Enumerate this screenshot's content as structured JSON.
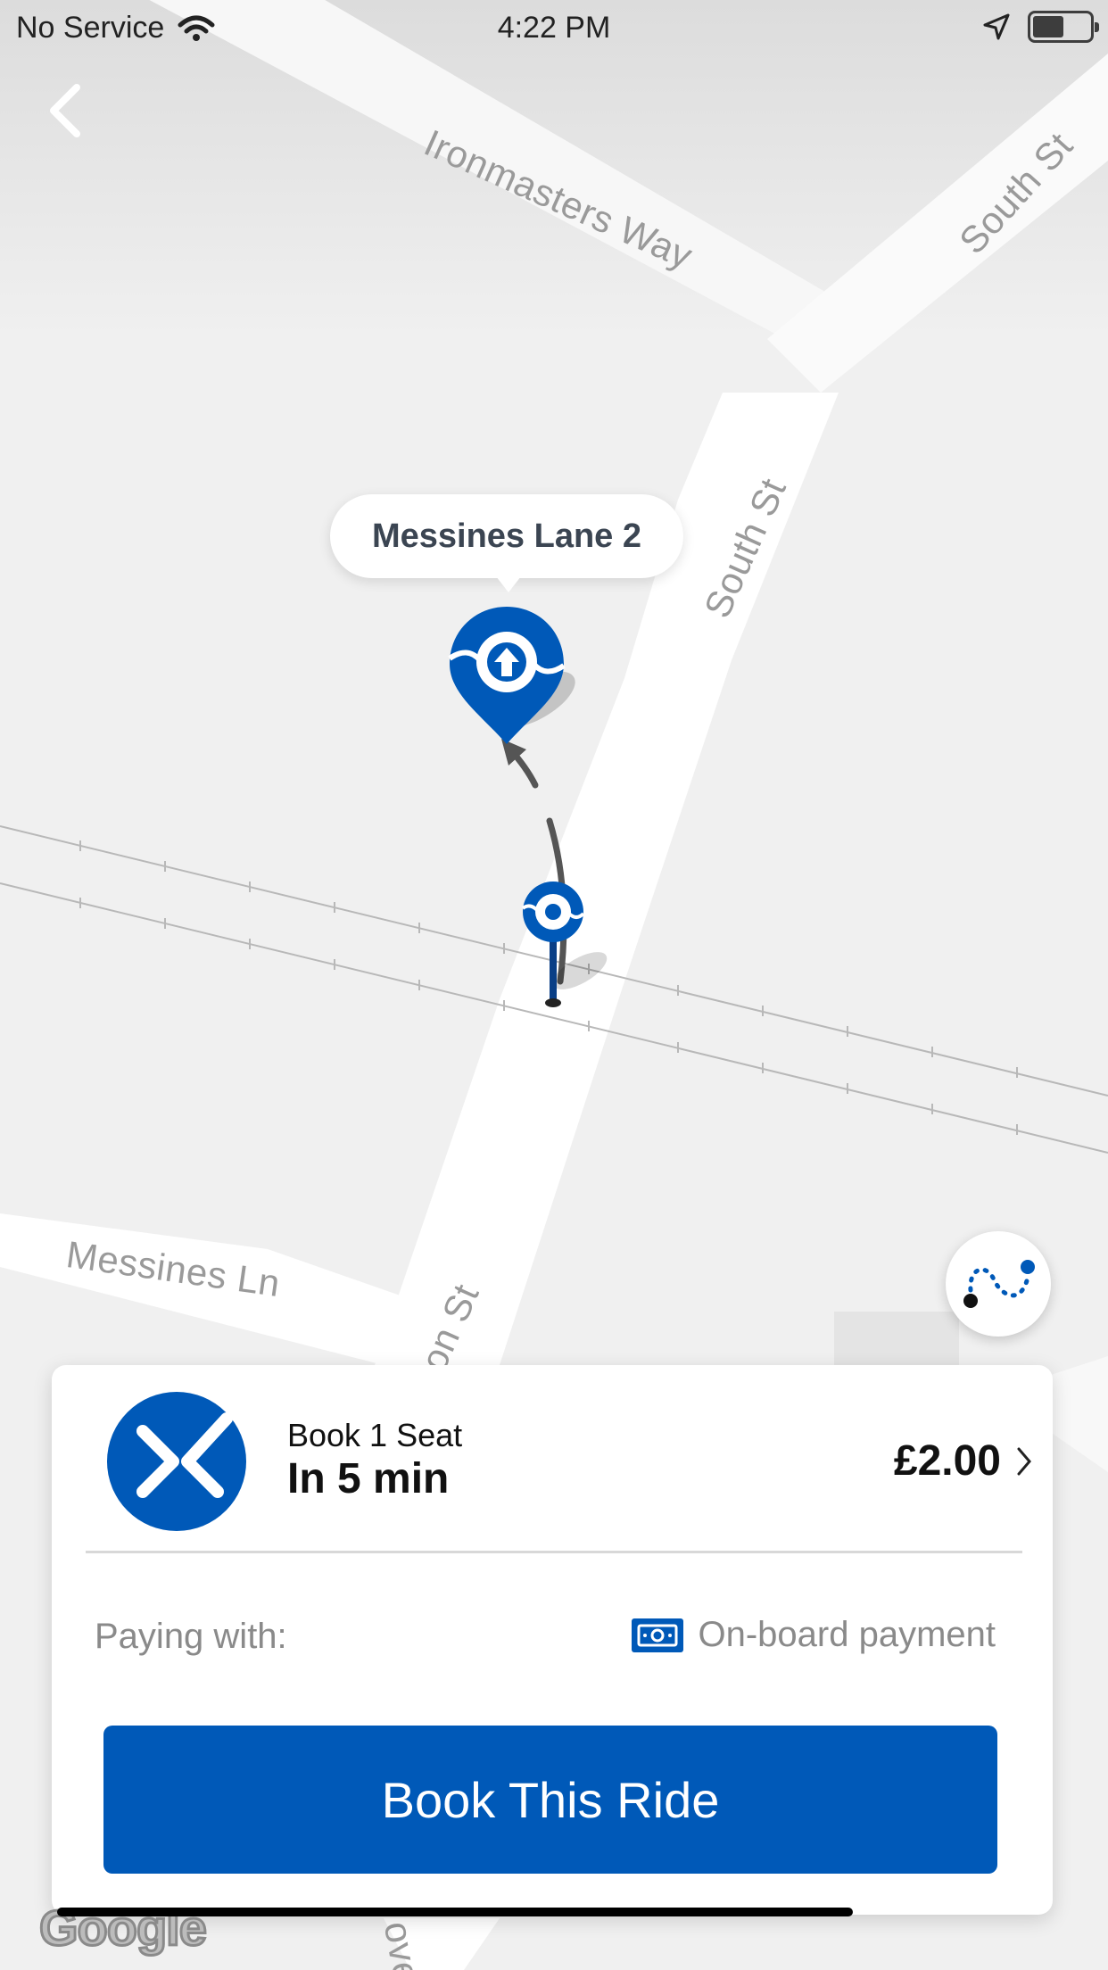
{
  "status_bar": {
    "carrier": "No Service",
    "time": "4:22 PM"
  },
  "map": {
    "streets": [
      "Ironmasters Way",
      "South St",
      "South St",
      "Messines Ln",
      "on St",
      "ove"
    ],
    "pickup_callout": "Messines Lane 2",
    "attribution": "Google"
  },
  "ride": {
    "subtitle": "Book 1 Seat",
    "eta": "In 5 min",
    "price": "£2.00"
  },
  "payment": {
    "label": "Paying with:",
    "method": "On-board payment"
  },
  "book_button": "Book This Ride",
  "colors": {
    "brand_blue": "#0059b8",
    "map_road": "#ffffff",
    "map_background": "#f0f0f0"
  },
  "icons": [
    "wifi-icon",
    "location-arrow-icon",
    "battery-icon",
    "back-chevron-icon",
    "pickup-pin-icon",
    "current-location-pin-icon",
    "route-icon",
    "brand-logo-icon",
    "chevron-right-icon",
    "cash-icon"
  ]
}
